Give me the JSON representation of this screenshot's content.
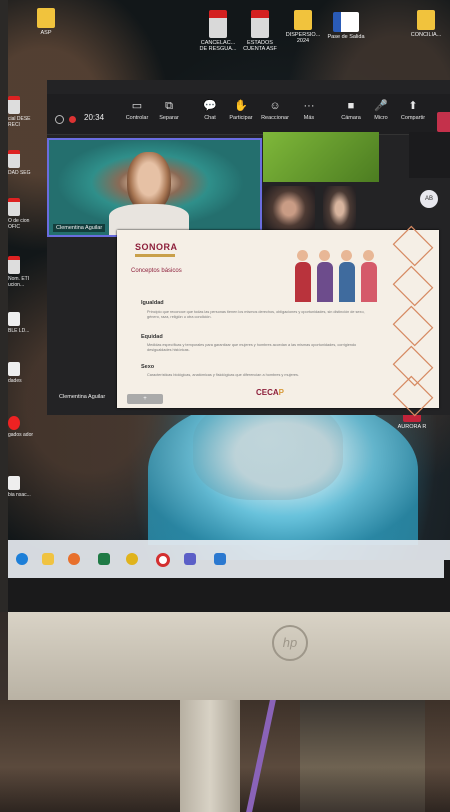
{
  "desktop": {
    "top_icons": [
      {
        "label": "ASP",
        "type": "folder"
      },
      {
        "label": "CANCELAC... DE RESGUA...",
        "type": "pdf"
      },
      {
        "label": "ESTADOS CUENTA ASF",
        "type": "pdf"
      },
      {
        "label": "DISPERSIO... 2024",
        "type": "folder"
      },
      {
        "label": "Pase de Salida",
        "type": "word"
      },
      {
        "label": "CONCILIA...",
        "type": "folder"
      }
    ],
    "left_icons": [
      {
        "label": "cial DESE RECI"
      },
      {
        "label": "DAD SEG"
      },
      {
        "label": "O de cion OFIC"
      },
      {
        "label": "Nom. ETI ucion..."
      },
      {
        "label": "BLE LD..."
      },
      {
        "label": "dades"
      },
      {
        "label": "gados ador"
      },
      {
        "label": "bia nsac..."
      }
    ],
    "right_icon": {
      "label": "AURORA R"
    }
  },
  "meeting": {
    "timer": "20:34",
    "controls": [
      {
        "label": "Controlar",
        "icon": "control-icon"
      },
      {
        "label": "Separar",
        "icon": "popout-icon"
      },
      {
        "label": "Chat",
        "icon": "chat-icon"
      },
      {
        "label": "Participar",
        "icon": "hand-icon"
      },
      {
        "label": "Reaccionar",
        "icon": "emoji-icon"
      },
      {
        "label": "Más",
        "icon": "more-icon"
      },
      {
        "label": "Cámara",
        "icon": "camera-icon"
      },
      {
        "label": "Micro",
        "icon": "mic-off-icon"
      },
      {
        "label": "Compartir",
        "icon": "share-icon"
      }
    ],
    "main_participant": "Clementina Aguilar",
    "bottom_label": "Clementina Aguilar",
    "avatar_initials": "AB"
  },
  "slide": {
    "logo": "SONORA",
    "section_title": "Conceptos básicos",
    "items": [
      {
        "term": "Igualdad",
        "text": "Principio que reconoce que todas las personas tienen los mismos derechos, obligaciones y oportunidades, sin distinción de sexo, género, raza, religión u otra condición."
      },
      {
        "term": "Equidad",
        "text": "Medidas específicas y temporales para garantizar que mujeres y hombres accedan a las mismas oportunidades, corrigiendo desigualdades históricas."
      },
      {
        "term": "Sexo",
        "text": "Características biológicas, anatómicas y fisiológicas que diferencian a hombres y mujeres."
      }
    ],
    "footer_brand_a": "CECA",
    "footer_brand_b": "P"
  },
  "monitor": {
    "brand": "hp"
  }
}
